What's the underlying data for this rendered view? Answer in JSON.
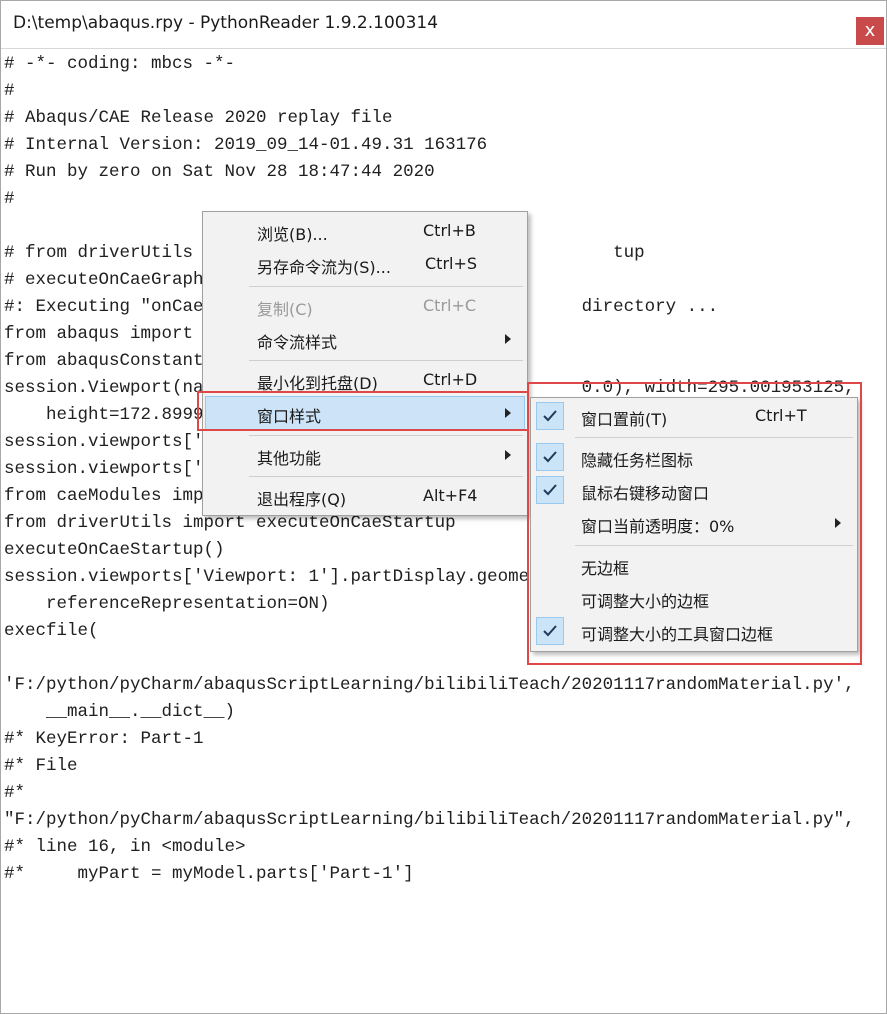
{
  "window": {
    "title": "D:\\temp\\abaqus.rpy - PythonReader 1.9.2.100314",
    "close_glyph": "x"
  },
  "code_lines": [
    "# -*- coding: mbcs -*-",
    "#",
    "# Abaqus/CAE Release 2020 replay file",
    "# Internal Version: 2019_09_14-01.49.31 163176",
    "# Run by zero on Sat Nov 28 18:47:44 2020",
    "#",
    "",
    "# from driverUtils                                        tup",
    "# executeOnCaeGraph",
    "#: Executing \"onCae                                    directory ...",
    "from abaqus import",
    "from abaqusConstant",
    "session.Viewport(na                                    0.0), width=295.001953125,",
    "    height=172.8999",
    "session.viewports['",
    "session.viewports['",
    "from caeModules imp",
    "from driverUtils import executeOnCaeStartup",
    "executeOnCaeStartup()",
    "session.viewports['Viewport: 1'].partDisplay.geome",
    "    referenceRepresentation=ON)",
    "execfile(",
    "",
    "'F:/python/pyCharm/abaqusScriptLearning/bilibiliTeach/20201117randomMaterial.py',",
    "    __main__.__dict__)",
    "#* KeyError: Part-1",
    "#* File",
    "#*",
    "\"F:/python/pyCharm/abaqusScriptLearning/bilibiliTeach/20201117randomMaterial.py\",",
    "#* line 16, in <module>",
    "#*     myPart = myModel.parts['Part-1']"
  ],
  "context_menu": {
    "items": [
      {
        "label": "浏览(B)...",
        "shortcut": "Ctrl+B"
      },
      {
        "label": "另存命令流为(S)...",
        "shortcut": "Ctrl+S"
      },
      {
        "label": "复制(C)",
        "shortcut": "Ctrl+C"
      },
      {
        "label": "命令流样式",
        "shortcut": ""
      },
      {
        "label": "最小化到托盘(D)",
        "shortcut": "Ctrl+D"
      },
      {
        "label": "窗口样式",
        "shortcut": ""
      },
      {
        "label": "其他功能",
        "shortcut": ""
      },
      {
        "label": "退出程序(Q)",
        "shortcut": "Alt+F4"
      }
    ]
  },
  "submenu": {
    "items": [
      {
        "label": "窗口置前(T)",
        "shortcut": "Ctrl+T",
        "checked": true
      },
      {
        "label": "隐藏任务栏图标",
        "shortcut": "",
        "checked": true
      },
      {
        "label": "鼠标右键移动窗口",
        "shortcut": "",
        "checked": true
      },
      {
        "label": "窗口当前透明度：0%",
        "shortcut": "",
        "checked": false
      },
      {
        "label": "无边框",
        "shortcut": "",
        "checked": false
      },
      {
        "label": "可调整大小的边框",
        "shortcut": "",
        "checked": false
      },
      {
        "label": "可调整大小的工具窗口边框",
        "shortcut": "",
        "checked": true
      }
    ]
  },
  "colors": {
    "highlight": "#cde3f7",
    "annotation": "#e04848",
    "close_button": "#c94a4a"
  }
}
